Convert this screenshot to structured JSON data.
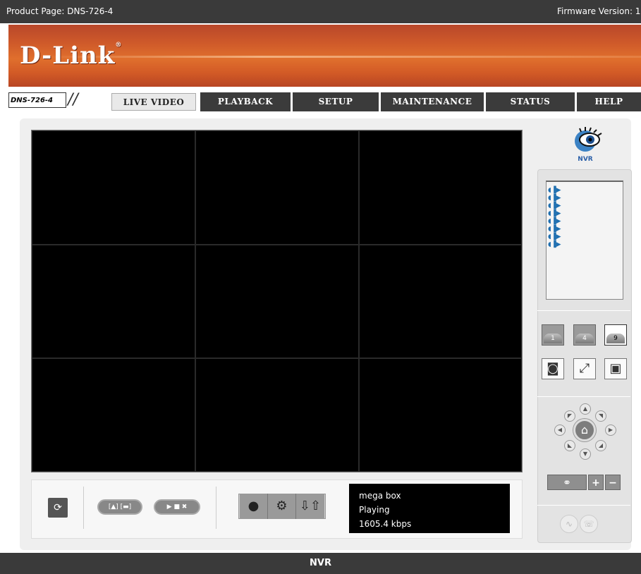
{
  "topbar": {
    "product_page": "Product Page: DNS-726-4",
    "firmware": "Firmware Version: 1"
  },
  "brand": {
    "logo_text": "D-Link",
    "logo_mark": "®"
  },
  "nav": {
    "model_tag": "DNS-726-4",
    "slashes": "//",
    "tabs": [
      {
        "label": "LIVE VIDEO",
        "active": true
      },
      {
        "label": "PLAYBACK",
        "active": false
      },
      {
        "label": "SETUP",
        "active": false
      },
      {
        "label": "MAINTENANCE",
        "active": false
      },
      {
        "label": "STATUS",
        "active": false
      },
      {
        "label": "HELP",
        "active": false
      }
    ]
  },
  "right_panel": {
    "nvr_label": "NVR",
    "camera_count": 8,
    "layouts": [
      "1",
      "4",
      "9"
    ]
  },
  "status": {
    "name": "mega box",
    "state": "Playing",
    "bitrate": "1605.4 kbps"
  },
  "footer": {
    "label": "NVR"
  },
  "colors": {
    "banner_orange": "#d8622a",
    "topbar_dark": "#3a3a3a",
    "nvr_blue": "#2a5fa8"
  }
}
